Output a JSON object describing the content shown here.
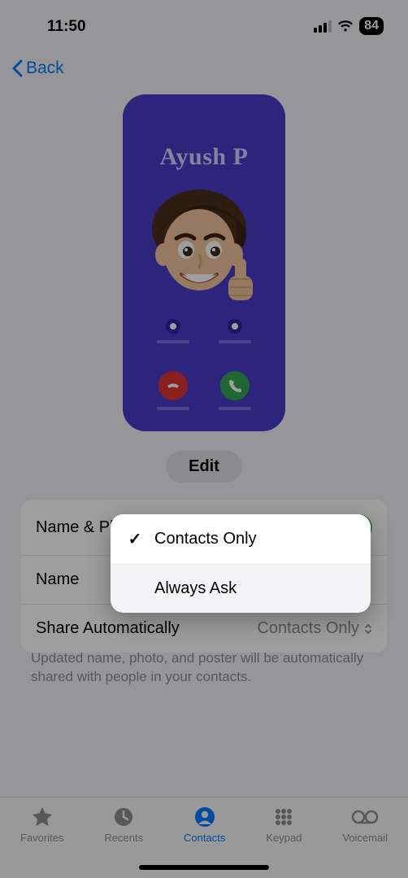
{
  "status": {
    "time": "11:50",
    "battery": "84"
  },
  "nav": {
    "back_label": "Back"
  },
  "poster": {
    "name": "Ayush P"
  },
  "edit_label": "Edit",
  "rows": {
    "sharing_label": "Name & Photo Sharing",
    "name_label": "Name",
    "auto_label": "Share Automatically",
    "auto_value": "Contacts Only"
  },
  "footer": "Updated name, photo, and poster will be automatically shared with people in your contacts.",
  "tabs": {
    "favorites": "Favorites",
    "recents": "Recents",
    "contacts": "Contacts",
    "keypad": "Keypad",
    "voicemail": "Voicemail"
  },
  "popover": {
    "option1": "Contacts Only",
    "option2": "Always Ask"
  }
}
